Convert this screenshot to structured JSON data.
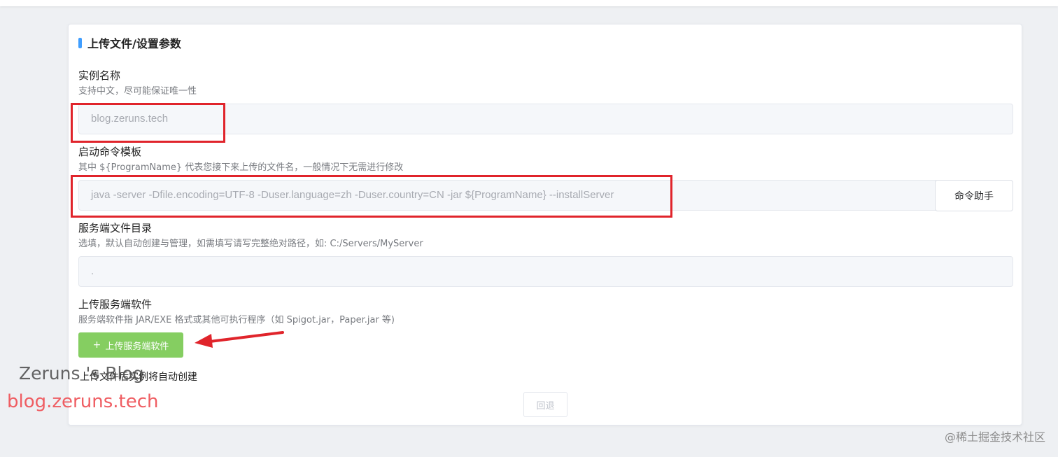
{
  "section_title": "上传文件/设置参数",
  "fields": {
    "instance_name": {
      "label": "实例名称",
      "hint": "支持中文，尽可能保证唯一性",
      "value": "blog.zeruns.tech"
    },
    "start_command": {
      "label": "启动命令模板",
      "hint": "其中 ${ProgramName} 代表您接下来上传的文件名，一般情况下无需进行修改",
      "value": "java -server -Dfile.encoding=UTF-8 -Duser.language=zh -Duser.country=CN -jar ${ProgramName} --installServer",
      "helper_button": "命令助手"
    },
    "server_dir": {
      "label": "服务端文件目录",
      "hint": "选填，默认自动创建与管理，如需填写请写完整绝对路径，如: C:/Servers/MyServer",
      "value": "."
    },
    "upload": {
      "label": "上传服务端软件",
      "hint": "服务端软件指 JAR/EXE 格式或其他可执行程序（如 Spigot.jar，Paper.jar 等)",
      "button": "上传服务端软件",
      "button_icon": "plus-icon",
      "after_text": "上传文件后实例将自动创建"
    }
  },
  "back_button": "回退",
  "watermarks": {
    "blog_name": "Zeruns 's Blog",
    "blog_url": "blog.zeruns.tech",
    "site": "@稀土掘金技术社区"
  },
  "colors": {
    "accent": "#409eff",
    "upload_button": "#85ce61",
    "highlight": "#e0242b"
  }
}
